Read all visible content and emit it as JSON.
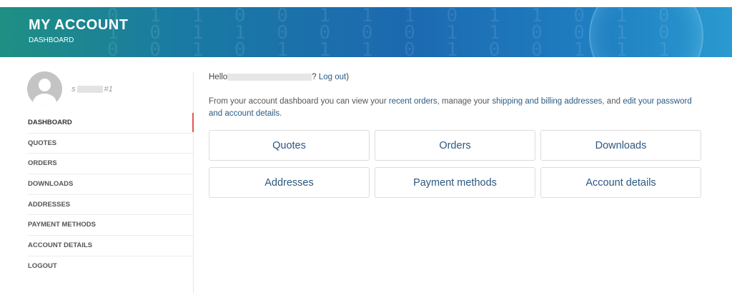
{
  "banner": {
    "title": "MY ACCOUNT",
    "subtitle": "DASHBOARD",
    "gradient_colors": [
      "#1f8f83",
      "#1c69b0",
      "#2a9ad0"
    ]
  },
  "sidebar": {
    "username_suffix": "#1",
    "active_color": "#e2574c",
    "items": [
      {
        "label": "DASHBOARD",
        "active": true
      },
      {
        "label": "QUOTES"
      },
      {
        "label": "ORDERS"
      },
      {
        "label": "DOWNLOADS"
      },
      {
        "label": "ADDRESSES"
      },
      {
        "label": "PAYMENT METHODS"
      },
      {
        "label": "ACCOUNT DETAILS"
      },
      {
        "label": "LOGOUT"
      }
    ]
  },
  "content": {
    "hello_prefix": "Hello",
    "hello_suffix": "? ",
    "logout_link": "Log out",
    "hello_close": ")",
    "intro": {
      "part1": "From your account dashboard you can view your ",
      "link1": "recent orders",
      "part2": ", manage your ",
      "link2": "shipping and billing addresses",
      "part3": ", and ",
      "link3": "edit your password and account details",
      "part4": "."
    },
    "tiles": [
      "Quotes",
      "Orders",
      "Downloads",
      "Addresses",
      "Payment methods",
      "Account details"
    ],
    "link_color": "#2a5b84"
  }
}
